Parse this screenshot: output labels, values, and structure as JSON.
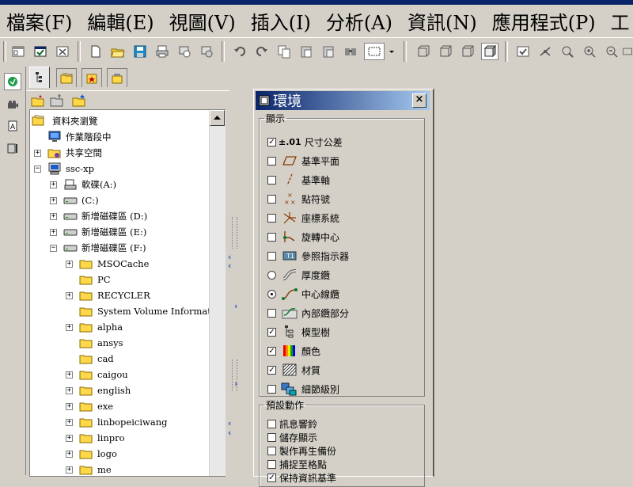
{
  "menu": [
    "檔案(F)",
    "編輯(E)",
    "視圖(V)",
    "插入(I)",
    "分析(A)",
    "資訊(N)",
    "應用程式(P)",
    "工"
  ],
  "toolbar_icons": [
    "window-icon",
    "window-activate-icon",
    "window-close-icon",
    "new-icon",
    "open-icon",
    "save-icon",
    "print-icon",
    "copy-print-icon",
    "backup-icon",
    "undo-icon",
    "redo-icon",
    "copy-icon",
    "paste-icon",
    "paste-special-icon",
    "find-icon",
    "select-box-icon",
    "dropdown-icon",
    "repaint-icon",
    "wireframe-icon",
    "hidden-line-icon",
    "shaded-icon",
    "regenerate-icon",
    "spin-center-icon",
    "orient-icon",
    "zoom-in-icon",
    "zoom-out-icon",
    "fit-icon"
  ],
  "navigator": {
    "root": "資料夾瀏覽",
    "tree": [
      {
        "label": "作業階段中",
        "level": 1,
        "expander": "",
        "icon": "monitor-icon"
      },
      {
        "label": "共享空間",
        "level": 1,
        "expander": "+",
        "icon": "shared-icon"
      },
      {
        "label": "ssc-xp",
        "level": 1,
        "expander": "-",
        "icon": "computer-icon"
      },
      {
        "label": "軟碟(A:)",
        "level": 2,
        "expander": "+",
        "icon": "floppy-icon"
      },
      {
        "label": "(C:)",
        "level": 2,
        "expander": "+",
        "icon": "drive-icon"
      },
      {
        "label": "新增磁碟區 (D:)",
        "level": 2,
        "expander": "+",
        "icon": "drive-icon"
      },
      {
        "label": "新增磁碟區 (E:)",
        "level": 2,
        "expander": "+",
        "icon": "drive-icon"
      },
      {
        "label": "新增磁碟區 (F:)",
        "level": 2,
        "expander": "-",
        "icon": "drive-icon"
      },
      {
        "label": "MSOCache",
        "level": 3,
        "expander": "+",
        "icon": "folder-icon"
      },
      {
        "label": "PC",
        "level": 3,
        "expander": "",
        "icon": "folder-icon"
      },
      {
        "label": "RECYCLER",
        "level": 3,
        "expander": "+",
        "icon": "folder-icon"
      },
      {
        "label": "System Volume Information",
        "level": 3,
        "expander": "",
        "icon": "folder-icon"
      },
      {
        "label": "alpha",
        "level": 3,
        "expander": "+",
        "icon": "folder-icon"
      },
      {
        "label": "ansys",
        "level": 3,
        "expander": "",
        "icon": "folder-icon"
      },
      {
        "label": "cad",
        "level": 3,
        "expander": "",
        "icon": "folder-icon"
      },
      {
        "label": "caigou",
        "level": 3,
        "expander": "+",
        "icon": "folder-icon"
      },
      {
        "label": "english",
        "level": 3,
        "expander": "+",
        "icon": "folder-icon"
      },
      {
        "label": "exe",
        "level": 3,
        "expander": "+",
        "icon": "folder-icon"
      },
      {
        "label": "linbopeiciwang",
        "level": 3,
        "expander": "+",
        "icon": "folder-icon"
      },
      {
        "label": "linpro",
        "level": 3,
        "expander": "+",
        "icon": "folder-icon"
      },
      {
        "label": "logo",
        "level": 3,
        "expander": "+",
        "icon": "folder-icon"
      },
      {
        "label": "me",
        "level": 3,
        "expander": "+",
        "icon": "folder-icon"
      }
    ]
  },
  "env": {
    "title": "環境",
    "close": "×",
    "display_group": "顯示",
    "display_items": [
      {
        "label": "尺寸公差",
        "prefix": "±.01",
        "checked": true,
        "control": "checkbox",
        "icon": "tolerance-icon"
      },
      {
        "label": "基準平面",
        "checked": false,
        "control": "checkbox",
        "icon": "datum-plane-icon"
      },
      {
        "label": "基準軸",
        "checked": false,
        "control": "checkbox",
        "icon": "datum-axis-icon"
      },
      {
        "label": "點符號",
        "checked": false,
        "control": "checkbox",
        "icon": "point-symbol-icon"
      },
      {
        "label": "座標系統",
        "checked": false,
        "control": "checkbox",
        "icon": "csys-icon"
      },
      {
        "label": "旋轉中心",
        "checked": false,
        "control": "checkbox",
        "icon": "spin-center-icon"
      },
      {
        "label": "參照指示器",
        "checked": false,
        "control": "checkbox",
        "icon": "ref-designator-icon"
      },
      {
        "label": "厚度纜",
        "checked": false,
        "control": "radio",
        "icon": "thick-cable-icon"
      },
      {
        "label": "中心線纜",
        "checked": true,
        "control": "radio",
        "icon": "centerline-cable-icon"
      },
      {
        "label": "內部纜部分",
        "checked": false,
        "control": "checkbox",
        "icon": "internal-cable-icon"
      },
      {
        "label": "模型樹",
        "checked": true,
        "control": "checkbox",
        "icon": "model-tree-icon"
      },
      {
        "label": "顏色",
        "checked": true,
        "control": "checkbox",
        "icon": "colors-icon"
      },
      {
        "label": "材質",
        "checked": true,
        "control": "checkbox",
        "icon": "texture-icon"
      },
      {
        "label": "細節級別",
        "checked": false,
        "control": "checkbox",
        "icon": "level-of-detail-icon"
      }
    ],
    "default_group": "預設動作",
    "default_items": [
      {
        "label": "訊息響鈴",
        "checked": false
      },
      {
        "label": "儲存顯示",
        "checked": false
      },
      {
        "label": "製作再生備份",
        "checked": false
      },
      {
        "label": "捕捉至格點",
        "checked": false
      },
      {
        "label": "保持資訊基準",
        "checked": true
      }
    ]
  },
  "colors": {
    "face": "#d4d0c8",
    "titlebar": "#0a246a",
    "titlebar_end": "#a6caf0",
    "folder": "#ffd84a"
  }
}
